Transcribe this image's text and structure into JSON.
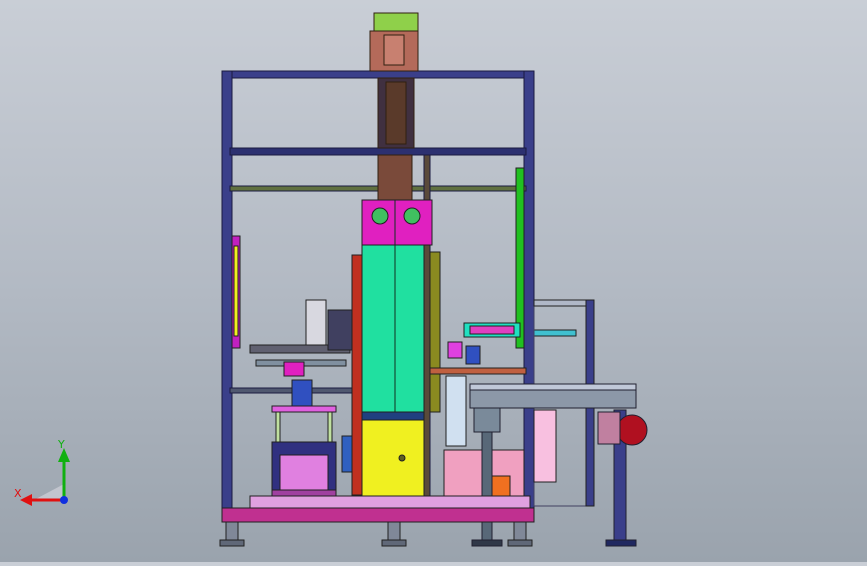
{
  "viewport": {
    "triad": {
      "x_label": "X",
      "y_label": "Y",
      "x_color": "#e01010",
      "y_color": "#10b010",
      "z_color": "#1030e0"
    },
    "palette": {
      "frame": "#3a3f8a",
      "motor_top": "#8fd04a",
      "motor_body": "#b46a5a",
      "ram_brown": "#7a4a3a",
      "magenta": "#e020c0",
      "cyan_green": "#20e0a0",
      "yellow": "#f0f020",
      "olive": "#8a8a20",
      "green_bar": "#20c020",
      "base_plate": "#c03090",
      "table_gray": "#8c98a8",
      "orange": "#f07020",
      "pink": "#f0a0c0",
      "red_disc": "#b01020"
    }
  }
}
